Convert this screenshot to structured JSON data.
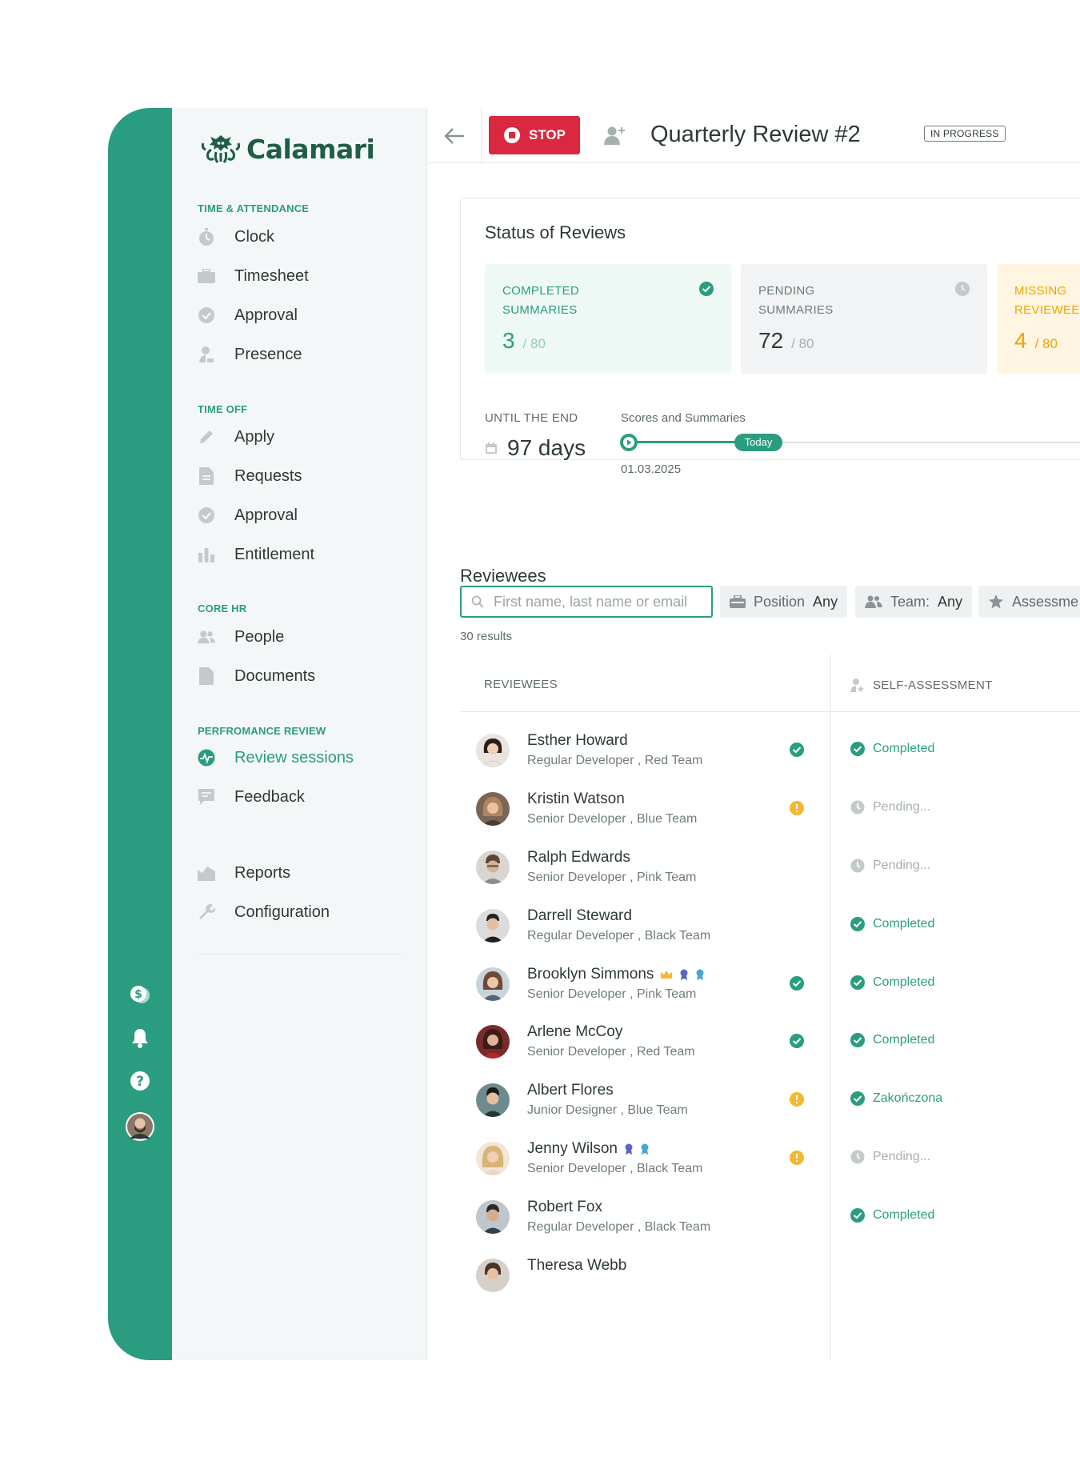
{
  "app": {
    "logo": "Calamari"
  },
  "sidebar": {
    "sections": [
      {
        "title": "TIME & ATTENDANCE",
        "items": [
          "Clock",
          "Timesheet",
          "Approval",
          "Presence"
        ]
      },
      {
        "title": "TIME OFF",
        "items": [
          "Apply",
          "Requests",
          "Approval",
          "Entitlement"
        ]
      },
      {
        "title": "CORE HR",
        "items": [
          "People",
          "Documents"
        ]
      },
      {
        "title": "PERFROMANCE REVIEW",
        "items": [
          "Review sessions",
          "Feedback"
        ]
      }
    ],
    "bottom_items": [
      "Reports",
      "Configuration"
    ],
    "active_item": "Review sessions"
  },
  "rail_icons": [
    "billing-icon",
    "bell-icon",
    "help-icon",
    "user-avatar"
  ],
  "header": {
    "stop_label": "STOP",
    "title": "Quarterly Review #2",
    "badge": "IN PROGRESS"
  },
  "status": {
    "title": "Status of Reviews",
    "tiles": [
      {
        "label_line1": "COMPLETED",
        "label_line2": "SUMMARIES",
        "value": "3",
        "of": "/ 80"
      },
      {
        "label_line1": "PENDING",
        "label_line2": "SUMMARIES",
        "value": "72",
        "of": "/ 80"
      },
      {
        "label_line1": "MISSING",
        "label_line2": "REVIEWEE",
        "value": "4",
        "of": "/ 80"
      }
    ],
    "until_label": "UNTIL THE END",
    "until_value": "97 days",
    "timeline_label": "Scores and Summaries",
    "today_label": "Today",
    "start_date": "01.03.2025"
  },
  "reviewees": {
    "title": "Reviewees",
    "search_placeholder": "First name, last name or email",
    "filters": [
      {
        "label": "Position",
        "value": "Any"
      },
      {
        "label": "Team:",
        "value": "Any"
      },
      {
        "label": "Assessme",
        "value": ""
      }
    ],
    "results": "30 results",
    "columns": [
      "REVIEWEES",
      "SELF-ASSESSMENT"
    ],
    "rows": [
      {
        "name": "Esther Howard",
        "role": "Regular Developer , Red Team",
        "mark": "check",
        "self": "Completed",
        "self_state": "done"
      },
      {
        "name": "Kristin Watson",
        "role": "Senior Developer , Blue Team",
        "mark": "warn",
        "self": "Pending...",
        "self_state": "pending"
      },
      {
        "name": "Ralph Edwards",
        "role": "Senior Developer , Pink Team",
        "mark": "",
        "self": "Pending...",
        "self_state": "pending"
      },
      {
        "name": "Darrell Steward",
        "role": "Regular Developer , Black Team",
        "mark": "",
        "self": "Completed",
        "self_state": "done"
      },
      {
        "name": "Brooklyn Simmons",
        "role": "Senior Developer , Pink Team",
        "mark": "check",
        "self": "Completed",
        "self_state": "done",
        "badges": [
          "crown-icon",
          "award-icon",
          "award-icon"
        ]
      },
      {
        "name": "Arlene McCoy",
        "role": "Senior Developer , Red Team",
        "mark": "check",
        "self": "Completed",
        "self_state": "done"
      },
      {
        "name": "Albert Flores",
        "role": "Junior Designer , Blue Team",
        "mark": "warn",
        "self": "Zakończona",
        "self_state": "done"
      },
      {
        "name": "Jenny Wilson",
        "role": "Senior Developer , Black Team",
        "mark": "warn",
        "self": "Pending...",
        "self_state": "pending",
        "badges": [
          "award-icon",
          "award-icon"
        ]
      },
      {
        "name": "Robert Fox",
        "role": "Regular Developer , Black Team",
        "mark": "",
        "self": "Completed",
        "self_state": "done"
      },
      {
        "name": "Theresa Webb",
        "role": "",
        "mark": "",
        "self": "",
        "self_state": "pending"
      }
    ]
  },
  "colors": {
    "brand": "#2a9d80",
    "stop": "#d9283f",
    "warning": "#f5b731",
    "pending_tile": "#f1f3f4",
    "completed_tile": "#eef8f5",
    "missing_tile": "#fff5e0"
  }
}
